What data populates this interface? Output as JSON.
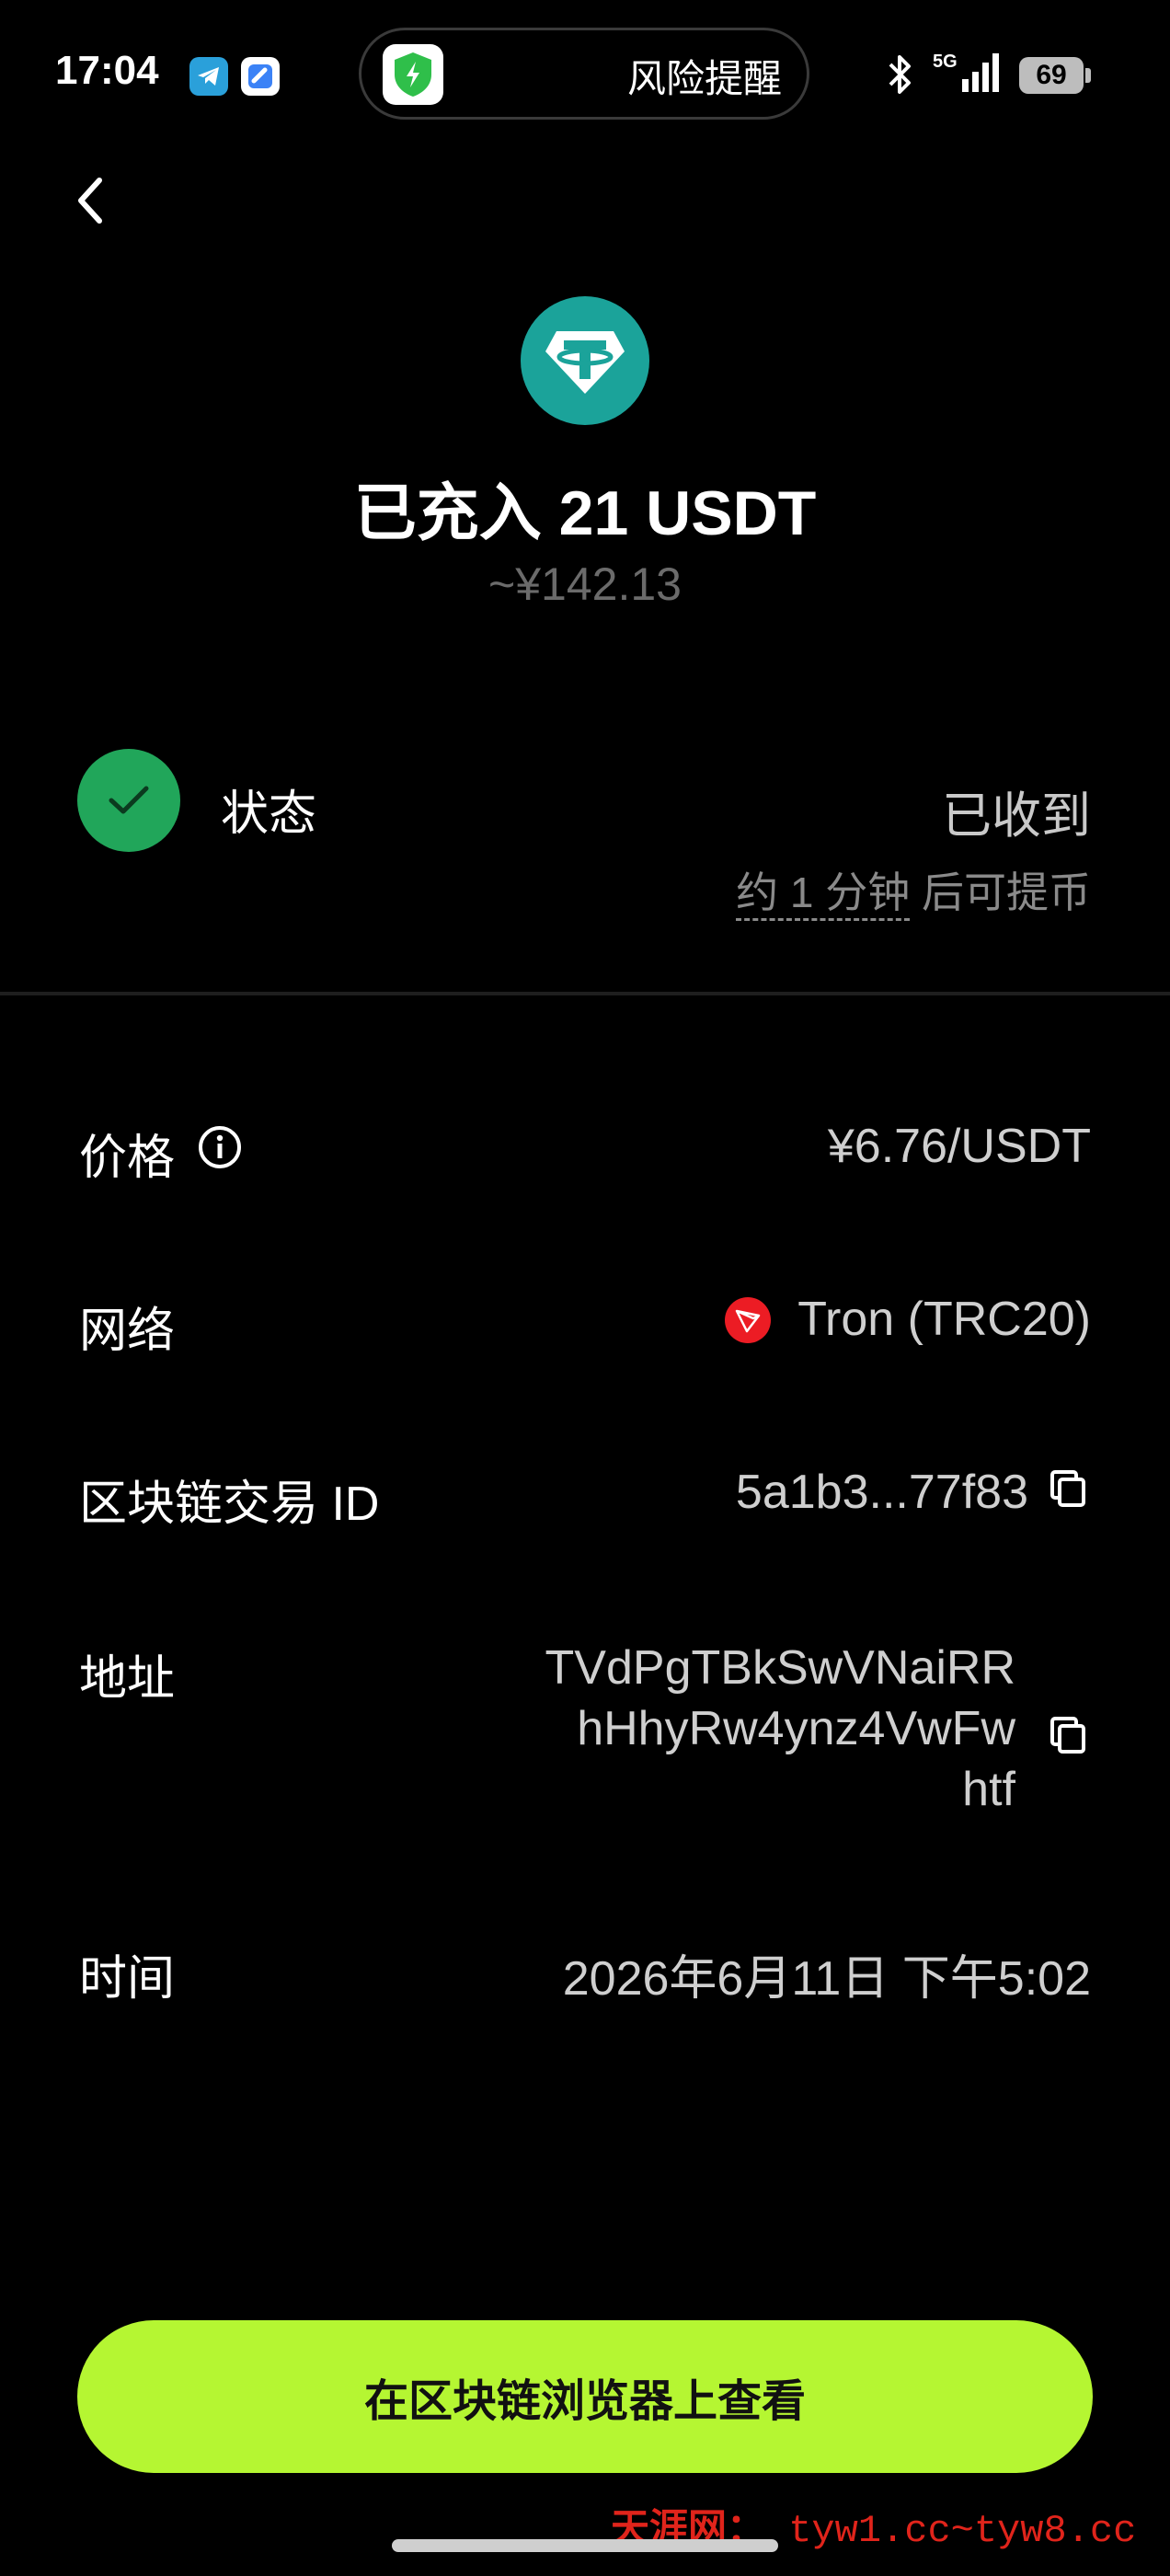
{
  "status_bar": {
    "time": "17:04",
    "app_icons": [
      "telegram-icon",
      "app-b-icon"
    ],
    "security_pill_label": "风险提醒",
    "network_label": "5G",
    "battery_level": "69"
  },
  "header": {
    "back_icon": "chevron-left-icon"
  },
  "hero": {
    "coin_icon": "tether-usdt-icon",
    "coin_color": "#1ba39a",
    "title": "已充入 21  USDT",
    "fiat_value": "~¥142.13"
  },
  "status": {
    "label": "状态",
    "value": "已收到",
    "withdraw_time": "约 1 分钟",
    "withdraw_suffix": " 后可提币",
    "check_color": "#21a65a"
  },
  "details": {
    "price": {
      "label": "价格",
      "value": "¥6.76/USDT"
    },
    "network": {
      "label": "网络",
      "value": "Tron (TRC20)",
      "icon_color": "#ec1c24"
    },
    "tx_id": {
      "label": "区块链交易 ID",
      "value": "5a1b3...77f83"
    },
    "address": {
      "label": "地址",
      "lines": [
        "TVdPgTBkSwVNaiRR",
        "hHhyRw4ynz4VwFw",
        "htf"
      ]
    },
    "time": {
      "label": "时间",
      "value": "2026年6月11日 下午5:02"
    }
  },
  "cta": {
    "label": "在区块链浏览器上查看",
    "color": "#b5f632"
  },
  "watermark": {
    "site": "天涯网：",
    "urls": " tyw1.cc~tyw8.cc"
  }
}
